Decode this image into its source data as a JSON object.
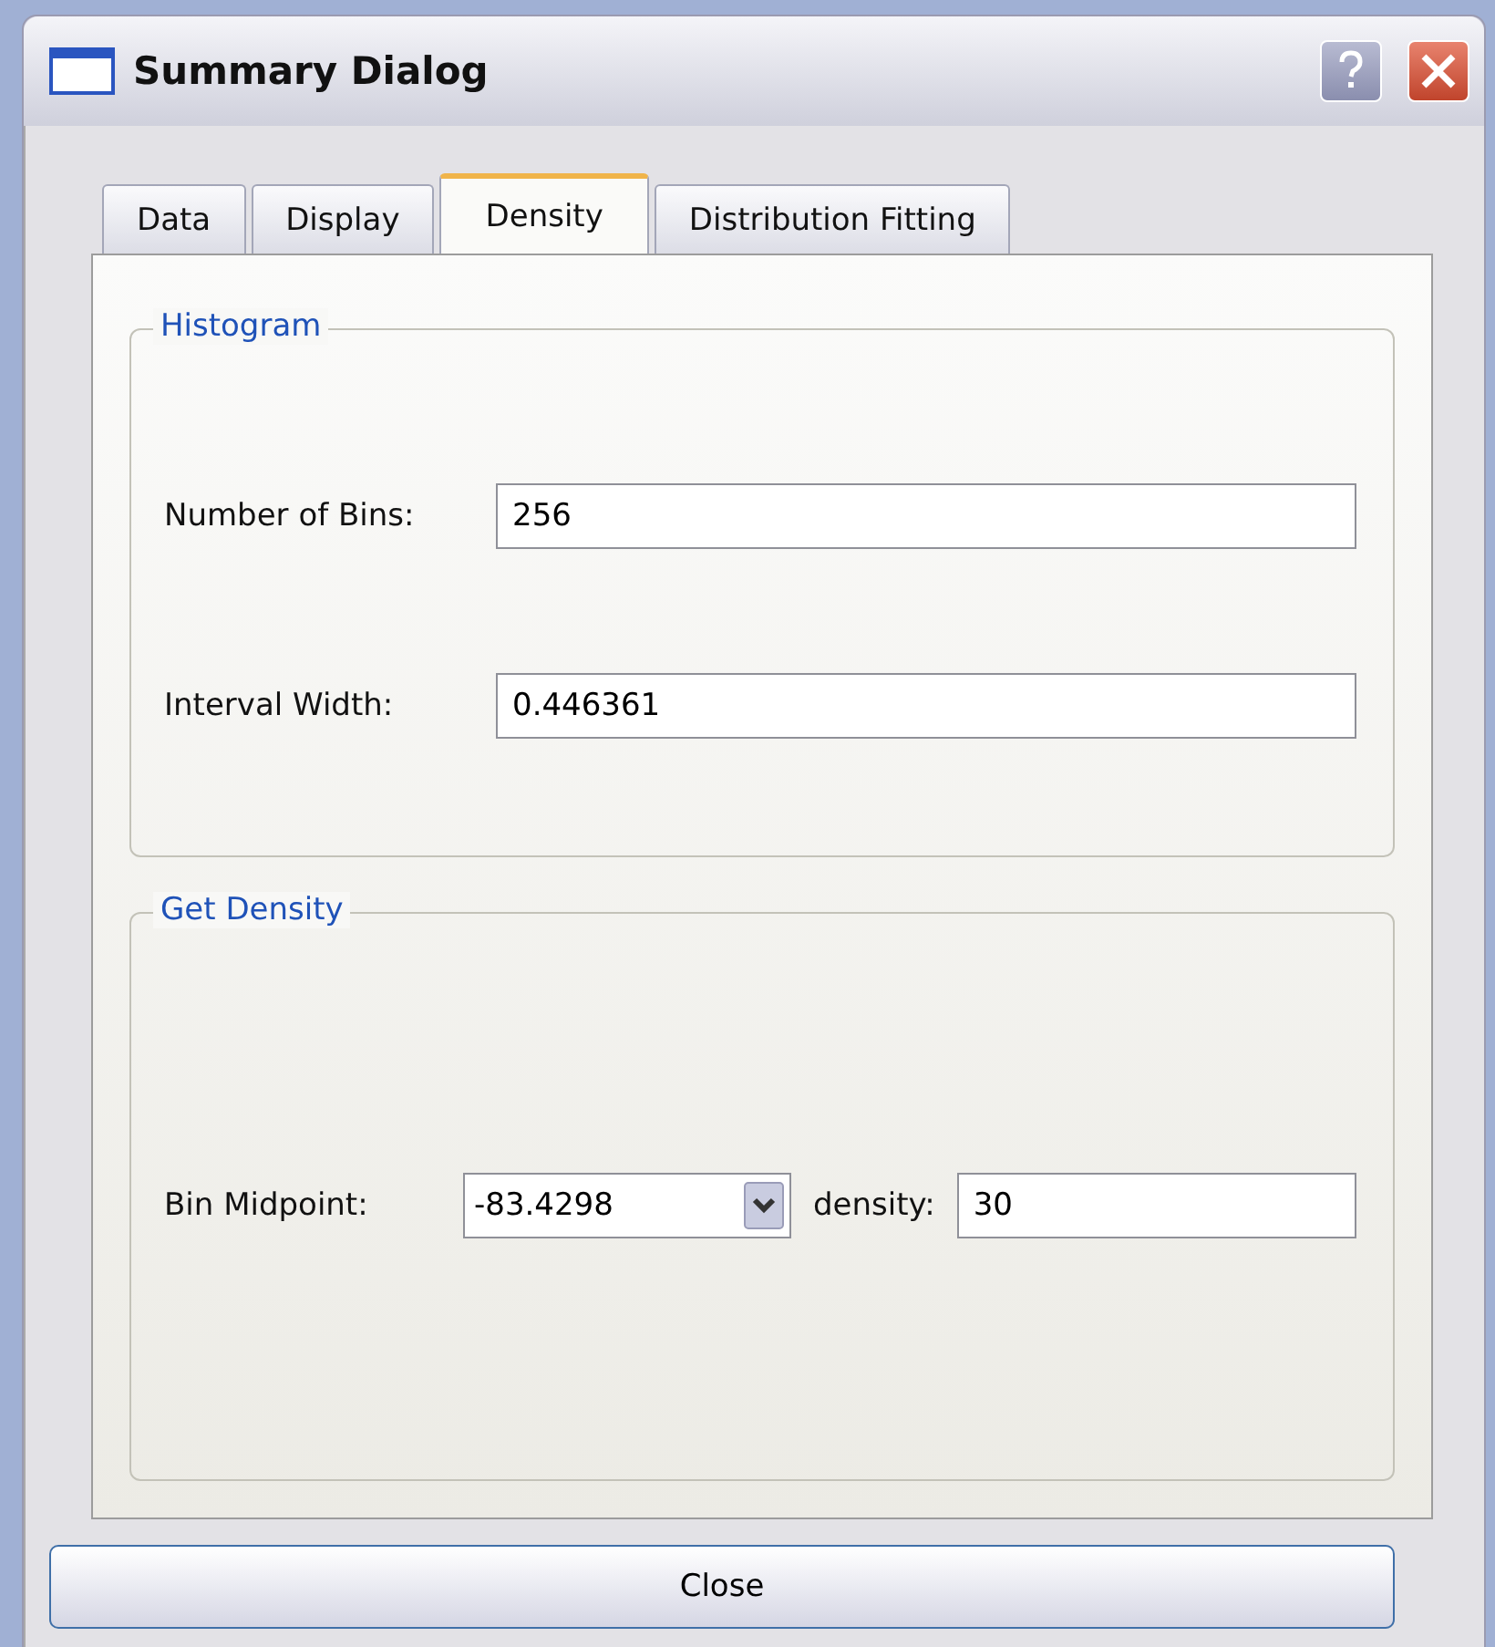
{
  "window": {
    "title": "Summary Dialog"
  },
  "tabs": [
    {
      "label": "Data",
      "selected": false
    },
    {
      "label": "Display",
      "selected": false
    },
    {
      "label": "Density",
      "selected": true
    },
    {
      "label": "Distribution Fitting",
      "selected": false
    }
  ],
  "groups": [
    {
      "title": "Histogram",
      "fields": [
        {
          "kind": "text",
          "label": "Number of Bins:",
          "value": "256"
        },
        {
          "kind": "text",
          "label": "Interval Width:",
          "value": "0.446361"
        }
      ]
    },
    {
      "title": "Get Density",
      "fields": [
        {
          "kind": "combo",
          "label": "Bin Midpoint:",
          "value": "-83.4298",
          "extra_label": "density:",
          "extra_value": "30"
        }
      ]
    }
  ],
  "buttons": [
    "Close"
  ]
}
